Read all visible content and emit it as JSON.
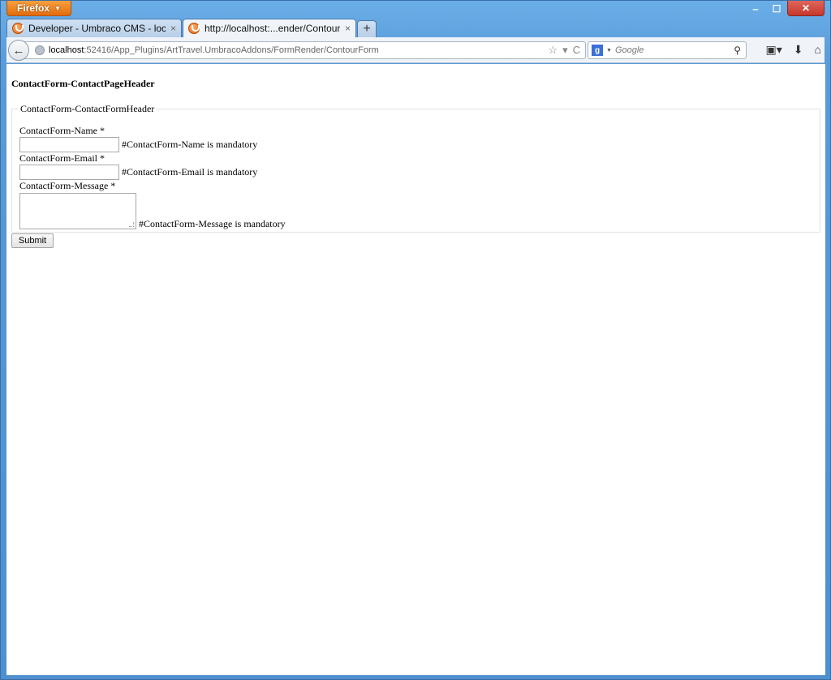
{
  "browser": {
    "menu_label": "Firefox",
    "controls": {
      "minimize": "‒",
      "maximize": "☐",
      "close": "✕"
    },
    "tabs": [
      {
        "label": "Developer - Umbraco CMS - localhost",
        "close": "×",
        "active": false
      },
      {
        "label": "http://localhost:...ender/ContourForm",
        "close": "×",
        "active": true
      }
    ],
    "new_tab": "+",
    "back": "←",
    "url_host": "localhost",
    "url_path": ":52416/App_Plugins/ArtTravel.UmbracoAddons/FormRender/ContourForm",
    "url_tools": {
      "star": "☆",
      "dropdown": "▾",
      "reload": "C"
    },
    "search": {
      "engine_icon": "g",
      "placeholder": "Google"
    }
  },
  "page": {
    "header": "ContactForm-ContactPageHeader",
    "form_header": "ContactForm-ContactFormHeader",
    "fields": {
      "name": {
        "label": "ContactForm-Name *",
        "value": "",
        "error": "#ContactForm-Name is mandatory"
      },
      "email": {
        "label": "ContactForm-Email *",
        "value": "",
        "error": "#ContactForm-Email is mandatory"
      },
      "message": {
        "label": "ContactForm-Message *",
        "value": "",
        "error": "#ContactForm-Message is mandatory"
      }
    },
    "submit_label": "Submit"
  },
  "icons": [
    "firefox-menu-icon",
    "umbraco-favicon",
    "globe-icon",
    "star-icon",
    "reload-icon",
    "google-icon",
    "search-icon",
    "bookmarks-icon",
    "download-icon",
    "home-icon"
  ]
}
